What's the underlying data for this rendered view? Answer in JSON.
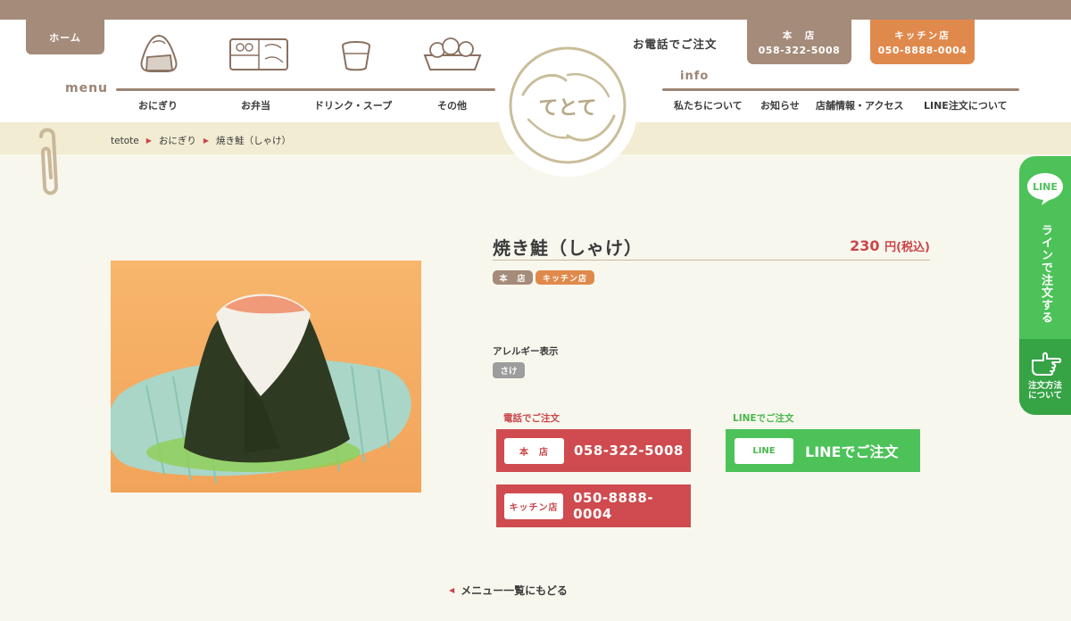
{
  "header": {
    "home_label": "ホーム",
    "menu_word": "menu",
    "info_word": "info",
    "menu_nav": [
      {
        "label": "おにぎり",
        "icon": "onigiri-icon"
      },
      {
        "label": "お弁当",
        "icon": "bento-icon"
      },
      {
        "label": "ドリンク・スープ",
        "icon": "soup-cup-icon"
      },
      {
        "label": "その他",
        "icon": "fried-food-icon"
      }
    ],
    "info_nav": [
      {
        "label": "私たちについて"
      },
      {
        "label": "お知らせ"
      },
      {
        "label": "店舗情報・アクセス"
      },
      {
        "label": "LINE注文について"
      }
    ],
    "phone_order_label": "お電話でご注文",
    "stores": [
      {
        "name": "本　店",
        "phone": "058-322-5008",
        "color": "#a58b7a"
      },
      {
        "name": "キッチン店",
        "phone": "050-8888-0004",
        "color": "#e0894c"
      }
    ],
    "logo_text": "てとて"
  },
  "breadcrumb": [
    "tetote",
    "おにぎり",
    "焼き鮭（しゃけ）"
  ],
  "product": {
    "title": "焼き鮭（しゃけ）",
    "price_num": "230",
    "price_unit": "円(税込)",
    "tags": [
      {
        "label": "本　店",
        "color": "#a58b7a"
      },
      {
        "label": "キッチン店",
        "color": "#e0894c"
      }
    ],
    "allergy_label": "アレルギー表示",
    "allergens": [
      "さけ"
    ]
  },
  "order": {
    "tel_label": "電話でご注文",
    "line_label": "LINEでご注文",
    "call_buttons": [
      {
        "store": "本　店",
        "phone": "058-322-5008"
      },
      {
        "store": "キッチン店",
        "phone": "050-8888-0004"
      }
    ],
    "line_button": {
      "chip": "LINE",
      "text": "LINEでご注文"
    }
  },
  "back_link": "メニュー一覧にもどる",
  "side_tab": {
    "badge": "LINE",
    "vertical_text": "ラインで注文する",
    "how_to": [
      "注文方法",
      "について"
    ]
  },
  "colors": {
    "accent_red": "#c9464a",
    "line_green": "#4cc259",
    "brown": "#a58b7a",
    "orange": "#e0894c",
    "background": "#f8f7ee"
  }
}
